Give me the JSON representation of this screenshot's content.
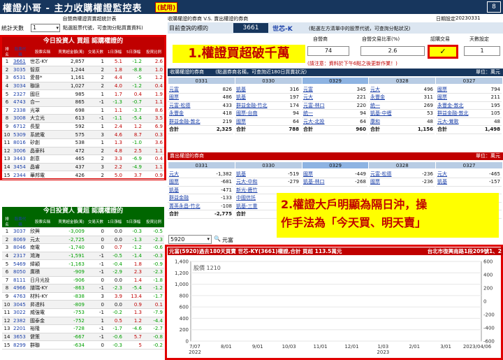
{
  "app": {
    "title": "權證小哥 - 主力收購權證監控表",
    "badge": "(試用)",
    "page": "8"
  },
  "left": {
    "subtitle": "自營商權證買賣超統計表",
    "days_label": "統計天數",
    "days_value": "1",
    "days_hint": "點選股票代號，可查詢分點買賣資料)",
    "buy": {
      "title": "今日投資人 買超 認購權證的",
      "headers": [
        "排名",
        "股票代碼",
        "股票名稱",
        "買賣超金額(萬)",
        "交易天數",
        "1日漲幅",
        "5日漲幅",
        "投資比例"
      ],
      "rows": [
        [
          "1",
          "3661",
          "世芯-KY",
          "2,857",
          "1",
          "5.1",
          "-1.2",
          "2.6"
        ],
        [
          "2",
          "3035",
          "智原",
          "1,244",
          "2",
          "1.8",
          "-8.8",
          "1.0"
        ],
        [
          "3",
          "6531",
          "愛普*",
          "1,161",
          "2",
          "4.4",
          "-5",
          "1.2"
        ],
        [
          "4",
          "3034",
          "聯詠",
          "1,027",
          "2",
          "4.0",
          "-1.2",
          "0.4"
        ],
        [
          "5",
          "2327",
          "國巨",
          "985",
          "1",
          "1.7",
          "0.4",
          "1.9"
        ],
        [
          "6",
          "4743",
          "合一",
          "865",
          "-1",
          "-1.3",
          "-0.7",
          "1.1"
        ],
        [
          "7",
          "2338",
          "光罩",
          "698",
          "1",
          "1.1",
          "-3.7",
          "8.6"
        ],
        [
          "8",
          "3008",
          "大立光",
          "613",
          "-1",
          "-1.1",
          "-5.4",
          "3.5"
        ],
        [
          "9",
          "6712",
          "長聖",
          "592",
          "1",
          "2.4",
          "1.2",
          "6.9"
        ],
        [
          "10",
          "5309",
          "系統電",
          "575",
          "3",
          "4.6",
          "8.7",
          "0.3"
        ],
        [
          "11",
          "8016",
          "矽創",
          "538",
          "1",
          "1.3",
          "-1.0",
          "3.6"
        ],
        [
          "12",
          "3006",
          "晶豪科",
          "472",
          "2",
          "4.8",
          "2.5",
          "1.1"
        ],
        [
          "13",
          "3443",
          "創意",
          "465",
          "2",
          "3.3",
          "-6.9",
          "0.4"
        ],
        [
          "14",
          "3454",
          "晶睿",
          "437",
          "3",
          "2.2",
          "-4.9",
          "1.1"
        ],
        [
          "15",
          "2344",
          "華邦電",
          "426",
          "2",
          "5.0",
          "3.7",
          "0.9"
        ]
      ]
    },
    "sell": {
      "title": "今日投資人 賣超 認購權證的",
      "headers": [
        "排名",
        "股票代碼",
        "股票名稱",
        "買賣超金額(萬)",
        "交易天數",
        "1日漲幅",
        "5日漲幅",
        "投資比例"
      ],
      "rows": [
        [
          "1",
          "3037",
          "欣興",
          "-3,009",
          "0",
          "0.0",
          "-0.3",
          "-0.5"
        ],
        [
          "2",
          "8069",
          "元太",
          "-2,725",
          "0",
          "0.0",
          "-1.3",
          "-2.3"
        ],
        [
          "3",
          "8046",
          "南電",
          "-1,740",
          "0",
          "0.7",
          "-1.2",
          "-0.6"
        ],
        [
          "4",
          "2317",
          "鴻海",
          "-1,591",
          "-1",
          "-0.5",
          "-1.4",
          "-0.3"
        ],
        [
          "5",
          "5469",
          "緯穎",
          "-1,163",
          "-1",
          "-0.4",
          "1.8",
          "-0.9"
        ],
        [
          "6",
          "8050",
          "廣積",
          "-909",
          "-1",
          "-2.9",
          "2.3",
          "-2.3"
        ],
        [
          "7",
          "8111",
          "日月光投",
          "-906",
          "0",
          "0.0",
          "1.4",
          "-1.8"
        ],
        [
          "8",
          "4966",
          "譜瑞-KY",
          "-863",
          "-1",
          "-2.3",
          "-5.4",
          "-1.2"
        ],
        [
          "9",
          "4763",
          "材料-KY",
          "-838",
          "3",
          "3.9",
          "13.4",
          "-1.7"
        ],
        [
          "10",
          "3045",
          "昇達科",
          "-809",
          "0",
          "0.0",
          "0.9",
          "0.1"
        ],
        [
          "11",
          "3022",
          "威強電",
          "-753",
          "-1",
          "-0.2",
          "1.3",
          "-7.9"
        ],
        [
          "12",
          "2382",
          "國泰金",
          "-752",
          "1",
          "0.5",
          "1.2",
          "-4.4"
        ],
        [
          "13",
          "2201",
          "裕隆",
          "-728",
          "-1",
          "-1.7",
          "-4.6",
          "-2.7"
        ],
        [
          "14",
          "3653",
          "健策",
          "-667",
          "-1",
          "-0.6",
          "5.7",
          "-0.8"
        ],
        [
          "15",
          "8299",
          "群聯",
          "-634",
          "0",
          "-0.3",
          "5",
          "-0.2"
        ]
      ]
    }
  },
  "right": {
    "title": "收購權證的券商 V.S. 賣出權證的券商",
    "date_label": "日期設定",
    "date_value": "20230331",
    "query_label": "目前查詢的標的",
    "stock_code": "3661",
    "stock_name": "世芯-K",
    "query_hint": "(點選左方清單中的股票代號，可查詢分點狀況)",
    "stat_headers": [
      "自營商",
      "自營交易比率(%)",
      "認購交易",
      "天數設定"
    ],
    "stat_values": [
      "74",
      "2.6",
      "✓",
      "1"
    ],
    "note": "(請注意：資料於下午6點之後更新作業！)",
    "buy_section": {
      "title": "收購權證的券商",
      "hint": "(點選券商名稱，可查詢近180日買賣狀況)",
      "unit": "單位：萬元",
      "dates": [
        "0331",
        "0330",
        "0329",
        "0328",
        "0327"
      ],
      "columns": [
        [
          [
            "元富",
            "826"
          ],
          [
            "國票",
            "486"
          ],
          [
            "元富-松德",
            "433"
          ],
          [
            "永豐金",
            "418"
          ],
          [
            "群益金融-敦北",
            "219"
          ],
          [
            "合計",
            "2,325"
          ]
        ],
        [
          [
            "凱基",
            "316"
          ],
          [
            "凱基",
            "197"
          ],
          [
            "群益金融-竹北",
            "174"
          ],
          [
            "國票-台南",
            "94"
          ],
          [
            "國票",
            "64"
          ],
          [
            "合計",
            "788"
          ]
        ],
        [
          [
            "元富",
            "345"
          ],
          [
            "元大",
            "221"
          ],
          [
            "元富-林口",
            "220"
          ],
          [
            "統一",
            "94"
          ],
          [
            "元大-北投",
            "64"
          ],
          [
            "合計",
            "960"
          ]
        ],
        [
          [
            "元大",
            "496"
          ],
          [
            "永豐金",
            "311"
          ],
          [
            "統一",
            "269"
          ],
          [
            "凱基-中壢",
            "53"
          ],
          [
            "康和",
            "48"
          ],
          [
            "合計",
            "1,156"
          ]
        ],
        [
          [
            "國票",
            "794"
          ],
          [
            "國票",
            "211"
          ],
          [
            "永豐金-敦北",
            "195"
          ],
          [
            "群益金融-敦北",
            "105"
          ],
          [
            "元大-鶯歌",
            "48"
          ],
          [
            "合計",
            "1,498"
          ]
        ]
      ]
    },
    "sell_section": {
      "title": "賣出權證的券商",
      "unit": "單位：萬元",
      "dates": [
        "0331",
        "0330",
        "0329",
        "0328",
        "0327"
      ],
      "columns": [
        [
          [
            "元大",
            "-1,382"
          ],
          [
            "國票",
            "-681"
          ],
          [
            "凱基",
            "-471"
          ],
          [
            "群益金融",
            "-133"
          ],
          [
            "菁英永昌-竹北",
            "-108"
          ],
          [
            "合計",
            "-2,775"
          ]
        ],
        [
          [
            "凱基",
            "-519"
          ],
          [
            "元大-中和",
            "-279"
          ],
          [
            "新光-鹿竹",
            ""
          ],
          [
            "中國信託",
            ""
          ],
          [
            "凱基-三重",
            ""
          ],
          [
            "合計",
            ""
          ]
        ],
        [
          [
            "國票",
            "-449"
          ],
          [
            "凱基-林口",
            "-268"
          ],
          [
            "",
            ""
          ],
          [
            "",
            ""
          ],
          [
            "",
            ""
          ],
          [
            "",
            ""
          ]
        ],
        [
          [
            "元富-松德",
            "-236"
          ],
          [
            "國票",
            "-236"
          ],
          [
            "",
            ""
          ],
          [
            "",
            ""
          ],
          [
            "",
            ""
          ],
          [
            "",
            ""
          ]
        ],
        [
          [
            "元大",
            "-465"
          ],
          [
            "凱基",
            "-157"
          ],
          [
            "",
            ""
          ],
          [
            "",
            ""
          ],
          [
            "",
            ""
          ],
          [
            "",
            ""
          ]
        ]
      ]
    },
    "search_value": "5920",
    "search_result": "元富",
    "chart_header": "元富(5920)過去180天買賣 世芯-KY(3661)權證,合計 買超 113.5萬元",
    "chart_address": "台北市復興南路1段209號1、2"
  },
  "callouts": {
    "one": "1.權證買超破千萬",
    "two_line1": "2.權證大戶明顯為隔日沖，操",
    "two_line2": "作手法為「今天買、明天賣」"
  },
  "chart_data": {
    "type": "line",
    "price_label": "股價 1210",
    "x_ticks": [
      "7/07\n2022",
      "8/01",
      "9/01",
      "10/03",
      "11/01",
      "12/01",
      "1/03\n2023",
      "2/01",
      "3/01",
      "2023/04/06"
    ],
    "y_left_ticks": [
      "1,400",
      "1,200",
      "1,000",
      "800",
      "600",
      "400",
      "200",
      "0"
    ],
    "y_right_ticks": [
      "600",
      "400",
      "200",
      "0",
      "-200",
      "-400",
      "-600"
    ],
    "ylim_left": [
      0,
      1400
    ],
    "ylim_right": [
      -600,
      600
    ],
    "series": [],
    "colors": {
      "price": "#777777",
      "buy": "#e00000",
      "sell": "#00a000"
    }
  }
}
